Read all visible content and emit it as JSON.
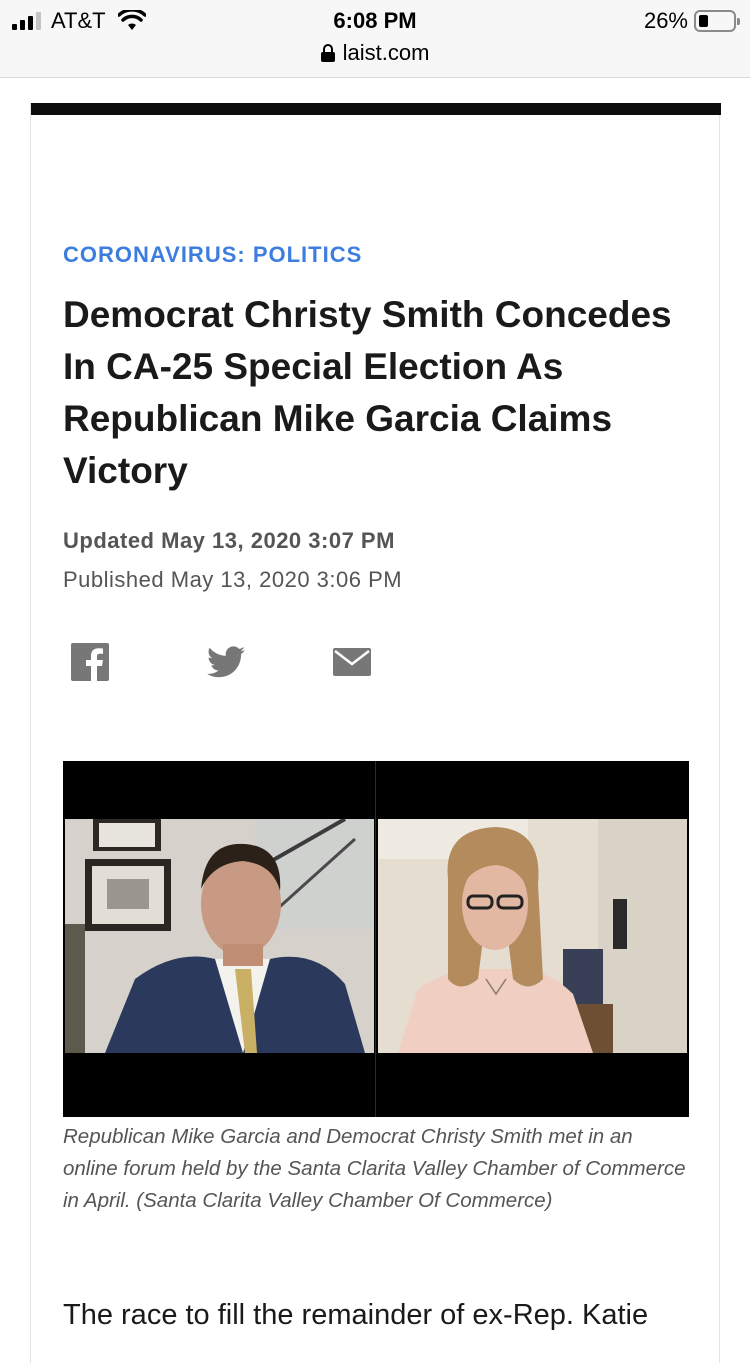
{
  "status_bar": {
    "carrier": "AT&T",
    "time": "6:08 PM",
    "url": "laist.com",
    "battery": "26%",
    "battery_level": 0.26
  },
  "article": {
    "kicker": "CORONAVIRUS: POLITICS",
    "headline": "Democrat Christy Smith Concedes In CA-25 Special Election As Republican Mike Garcia Claims Victory",
    "updated": "Updated May 13, 2020 3:07 PM",
    "published": "Published May 13, 2020 3:06 PM",
    "share": [
      "facebook-icon",
      "twitter-icon",
      "email-icon"
    ],
    "caption": "Republican Mike Garcia and Democrat Christy Smith met in an online forum held by the Santa Clarita Valley Chamber of Commerce in April. (Santa Clarita Valley Chamber Of Commerce)",
    "body_start": "The race to fill the remainder of ex-Rep. Katie"
  },
  "colors": {
    "kicker": "#3d7de0",
    "headline": "#1a1a1a",
    "meta": "#555555",
    "share_icons": "#777777"
  }
}
